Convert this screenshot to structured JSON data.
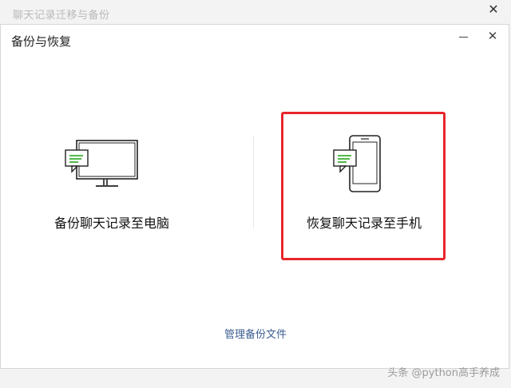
{
  "window": {
    "title": "聊天记录迁移与备份",
    "close_glyph": "✕"
  },
  "dialog": {
    "title": "备份与恢复",
    "close_glyph": "✕"
  },
  "options": {
    "backup_label": "备份聊天记录至电脑",
    "restore_label": "恢复聊天记录至手机"
  },
  "footer": {
    "manage_link": "管理备份文件"
  },
  "watermark": {
    "text": "头条 @python高手养成"
  },
  "icons": {
    "monitor": "monitor-icon",
    "phone": "phone-icon",
    "chat": "chat-bubble-icon"
  },
  "colors": {
    "highlight": "#e8262b",
    "chat_green": "#3cb034",
    "link": "#3b5d91"
  }
}
